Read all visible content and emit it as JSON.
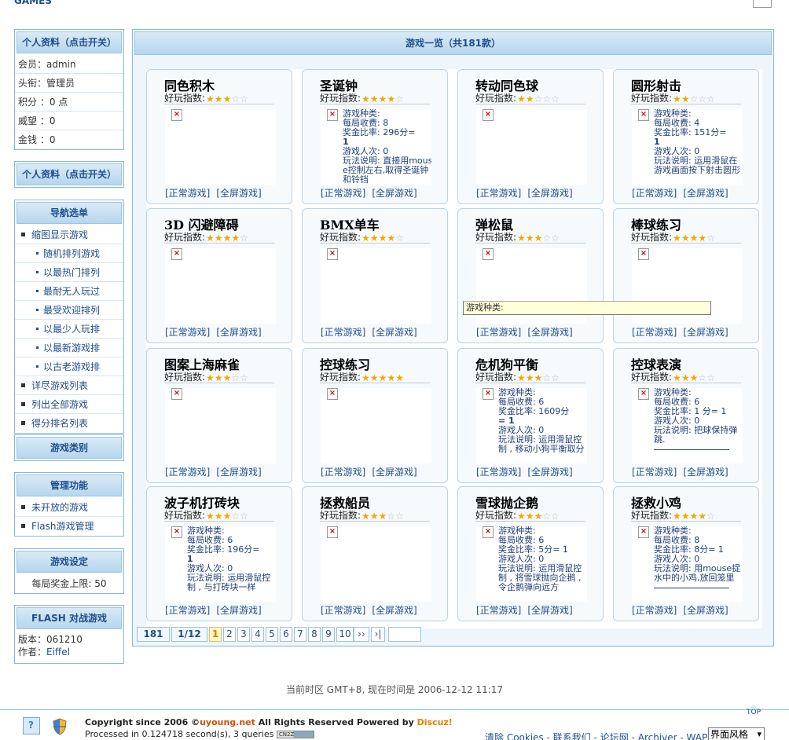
{
  "header": {
    "brand": "GAMES"
  },
  "sidebar": {
    "profile_title": "个人资料（点击开关）",
    "profile_rows": [
      "会员：admin",
      "头衔：管理员",
      "积分 ：0 点",
      "威望 ：0",
      "金钱 ：0"
    ],
    "profile_title_2": "个人资料（点击开关）",
    "nav_title": "导航选单",
    "nav_items": [
      {
        "label": "缩图显示游戏",
        "sub": false
      },
      {
        "label": "随机排列游戏",
        "sub": true
      },
      {
        "label": "以最热门排列",
        "sub": true
      },
      {
        "label": "最耐无人玩过",
        "sub": true
      },
      {
        "label": "最受欢迎排列",
        "sub": true
      },
      {
        "label": "以最少人玩排",
        "sub": true
      },
      {
        "label": "以最新游戏排",
        "sub": true
      },
      {
        "label": "以古老游戏排",
        "sub": true
      },
      {
        "label": "详尽游戏列表",
        "sub": false
      },
      {
        "label": "列出全部游戏",
        "sub": false
      },
      {
        "label": "得分排名列表",
        "sub": false
      }
    ],
    "category_title": "游戏类别",
    "admin_title": "管理功能",
    "admin_items": [
      "未开放的游戏",
      "Flash游戏管理"
    ],
    "settings_title": "游戏设定",
    "settings_row": "每局奖金上限: 50",
    "flash_title": "FLASH 对战游戏",
    "version_label": "版本：",
    "version_value": "061210",
    "author_label": "作者：",
    "author_value": "Eiffel"
  },
  "main": {
    "title": "游戏一览（共181款）",
    "rating_label": "好玩指数:",
    "link_normal": "[正常游戏]",
    "link_full": "[全屏游戏]",
    "tooltip": "游戏种类:",
    "games": [
      {
        "title": "同色积木",
        "stars": 3,
        "desc": []
      },
      {
        "title": "圣诞钟",
        "stars": 4,
        "desc": [
          "游戏种类:",
          "每局收费: 8",
          "奖金比率: 296分=",
          "1",
          "游戏人次: 0",
          "玩法说明: 直接用mouse控制左右,取得圣诞钟和铃铛"
        ]
      },
      {
        "title": "转动同色球",
        "stars": 2,
        "desc": []
      },
      {
        "title": "圆形射击",
        "stars": 2,
        "desc": [
          "游戏种类:",
          "每局收费: 4",
          "奖金比率: 151分=",
          "1",
          "游戏人次: 0",
          "玩法说明: 运用滑鼠在游戏画面按下射击圆形"
        ]
      },
      {
        "title": "3D 闪避障碍",
        "stars": 4,
        "desc": []
      },
      {
        "title": "BMX单车",
        "stars": 4,
        "desc": []
      },
      {
        "title": "弹松鼠",
        "stars": 3,
        "desc": []
      },
      {
        "title": "棒球练习",
        "stars": 4,
        "desc": []
      },
      {
        "title": "图案上海麻雀",
        "stars": 3,
        "desc": []
      },
      {
        "title": "控球练习",
        "stars": 5,
        "desc": []
      },
      {
        "title": "危机狗平衡",
        "stars": 3,
        "desc": [
          "游戏种类:",
          "每局收费: 6",
          "奖金比率: 1609分",
          "= 1",
          "游戏人次: 0",
          "玩法说明: 运用滑鼠控制 , 移动小狗平衡取分"
        ]
      },
      {
        "title": "控球表演",
        "stars": 3,
        "desc": [
          "游戏种类:",
          "每局收费: 6",
          "奖金比率: 1 分= 1",
          "游戏人次: 0",
          "玩法说明: 把球保持弹跳."
        ]
      },
      {
        "title": "波子机打砖块",
        "stars": 3,
        "desc": [
          "游戏种类:",
          "每局收费: 6",
          "奖金比率: 196分=",
          "1",
          "游戏人次: 0",
          "玩法说明: 运用滑鼠控制 , 与打砖块一样"
        ]
      },
      {
        "title": "拯救船员",
        "stars": 3,
        "desc": []
      },
      {
        "title": "雪球抛企鹅",
        "stars": 3,
        "desc": [
          "游戏种类:",
          "每局收费: 6",
          "奖金比率: 5分= 1",
          "游戏人次: 0",
          "玩法说明: 运用滑鼠控制 , 将雪球抛向企鹅 , 令企鹅弹向远方"
        ]
      },
      {
        "title": "拯救小鸡",
        "stars": 4,
        "desc": [
          "游戏种类:",
          "每局收费: 8",
          "奖金比率: 8分= 1",
          "游戏人次: 0",
          "玩法说明: 用mouse捉水中的小鸡,放回笼里"
        ]
      }
    ]
  },
  "pager": {
    "total": "181",
    "pages": "1/12",
    "numbers": [
      "1",
      "2",
      "3",
      "4",
      "5",
      "6",
      "7",
      "8",
      "9",
      "10"
    ],
    "current": "1",
    "next": "››",
    "last": "›|",
    "jump_value": ""
  },
  "footer": {
    "time_text": "当前时区  GMT+8, 现在时间是  2006-12-12 11:17",
    "top": "TOP",
    "copyright_a": "Copyright since 2006 ©",
    "copyright_site": "uyoung.net",
    "copyright_b": " All Rights Reserved Powered by ",
    "copyright_discuz": "Discuz!",
    "processed": "Processed in 0.124718 second(s), 3 queries",
    "badge": "CN2Z",
    "links": [
      "清除 Cookies",
      "联系我们",
      "论坛网",
      "Archiver",
      "WAP"
    ],
    "style_select": "界面风格"
  }
}
